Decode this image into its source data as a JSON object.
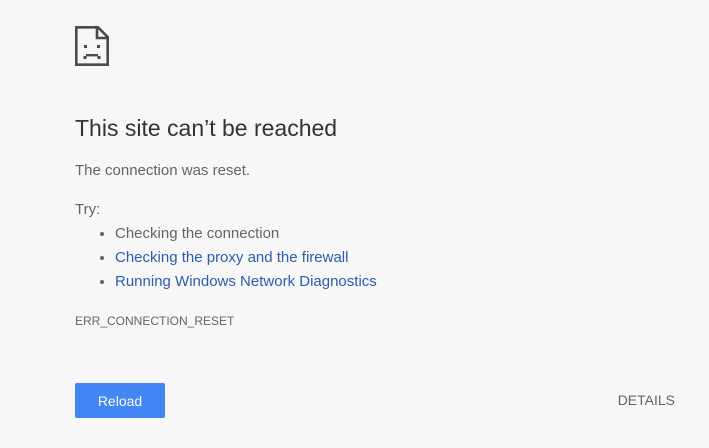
{
  "icon": "sad-page-icon",
  "heading": "This site can’t be reached",
  "summary": "The connection was reset.",
  "try_label": "Try:",
  "suggestions": [
    {
      "label": "Checking the connection",
      "link": false
    },
    {
      "label": "Checking the proxy and the firewall",
      "link": true
    },
    {
      "label": "Running Windows Network Diagnostics",
      "link": true
    }
  ],
  "error_code": "ERR_CONNECTION_RESET",
  "buttons": {
    "reload": "Reload",
    "details": "DETAILS"
  },
  "colors": {
    "background": "#f7f7f7",
    "heading": "#333333",
    "text": "#646464",
    "link": "#2a5db0",
    "primary_button": "#4285f4"
  }
}
